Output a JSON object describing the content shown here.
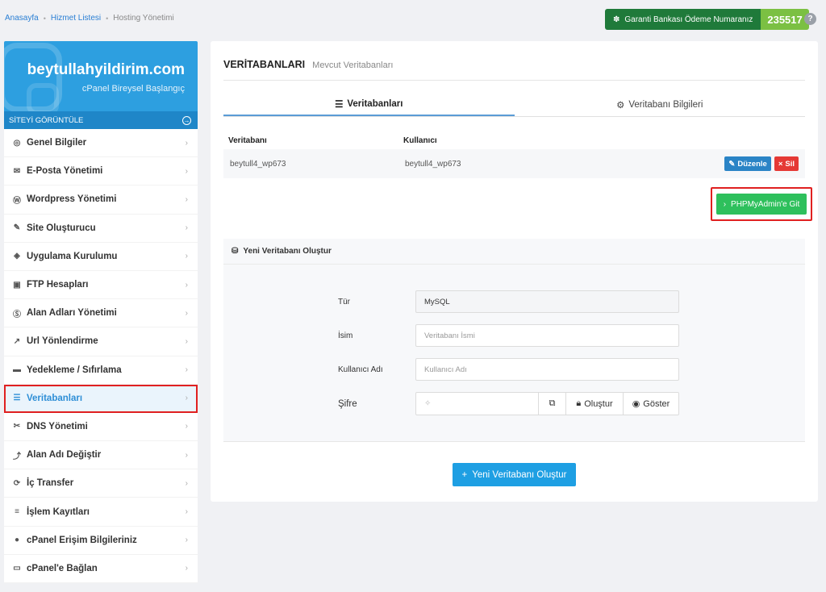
{
  "breadcrumb": {
    "home": "Anasayfa",
    "services": "Hizmet Listesi",
    "current": "Hosting Yönetimi"
  },
  "payment": {
    "label": "Garanti Bankası Ödeme Numaranız",
    "number": "235517"
  },
  "sidebar": {
    "domain": "beytullahyildirim.com",
    "plan": "cPanel Bireysel Başlangıç",
    "view_site": "SİTEYİ GÖRÜNTÜLE",
    "items": [
      {
        "label": "Genel Bilgiler",
        "icon": "◎"
      },
      {
        "label": "E-Posta Yönetimi",
        "icon": "✉"
      },
      {
        "label": "Wordpress Yönetimi",
        "icon": "Ⓦ"
      },
      {
        "label": "Site Oluşturucu",
        "icon": "✎"
      },
      {
        "label": "Uygulama Kurulumu",
        "icon": "◈"
      },
      {
        "label": "FTP Hesapları",
        "icon": "▣"
      },
      {
        "label": "Alan Adları Yönetimi",
        "icon": "Ⓢ"
      },
      {
        "label": "Url Yönlendirme",
        "icon": "↗"
      },
      {
        "label": "Yedekleme / Sıfırlama",
        "icon": "▬"
      },
      {
        "label": "Veritabanları",
        "icon": "☰"
      },
      {
        "label": "DNS Yönetimi",
        "icon": "✂"
      },
      {
        "label": "Alan Adı Değiştir",
        "icon": "⤴"
      },
      {
        "label": "İç Transfer",
        "icon": "⟳"
      },
      {
        "label": "İşlem Kayıtları",
        "icon": "≡"
      },
      {
        "label": "cPanel Erişim Bilgileriniz",
        "icon": "●"
      },
      {
        "label": "cPanel'e Bağlan",
        "icon": "▭"
      }
    ]
  },
  "main": {
    "title": "VERİTABANLARI",
    "subtitle": "Mevcut Veritabanları",
    "tabs": [
      {
        "label": "Veritabanları"
      },
      {
        "label": "Veritabanı Bilgileri"
      }
    ],
    "table": {
      "headers": [
        "Veritabanı",
        "Kullanıcı"
      ],
      "rows": [
        {
          "db": "beytull4_wp673",
          "user": "beytull4_wp673"
        }
      ],
      "edit_label": "Düzenle",
      "delete_label": "Sil"
    },
    "pma_label": "PHPMyAdmin'e Git",
    "new_db": {
      "title": "Yeni Veritabanı Oluştur",
      "type_label": "Tür",
      "type_value": "MySQL",
      "name_label": "İsim",
      "name_placeholder": "Veritabanı İsmi",
      "user_label": "Kullanıcı Adı",
      "user_placeholder": "Kullanıcı Adı",
      "password_label": "Şifre",
      "generate_label": "Oluştur",
      "show_label": "Göster",
      "submit_label": "Yeni Veritabanı Oluştur"
    }
  }
}
